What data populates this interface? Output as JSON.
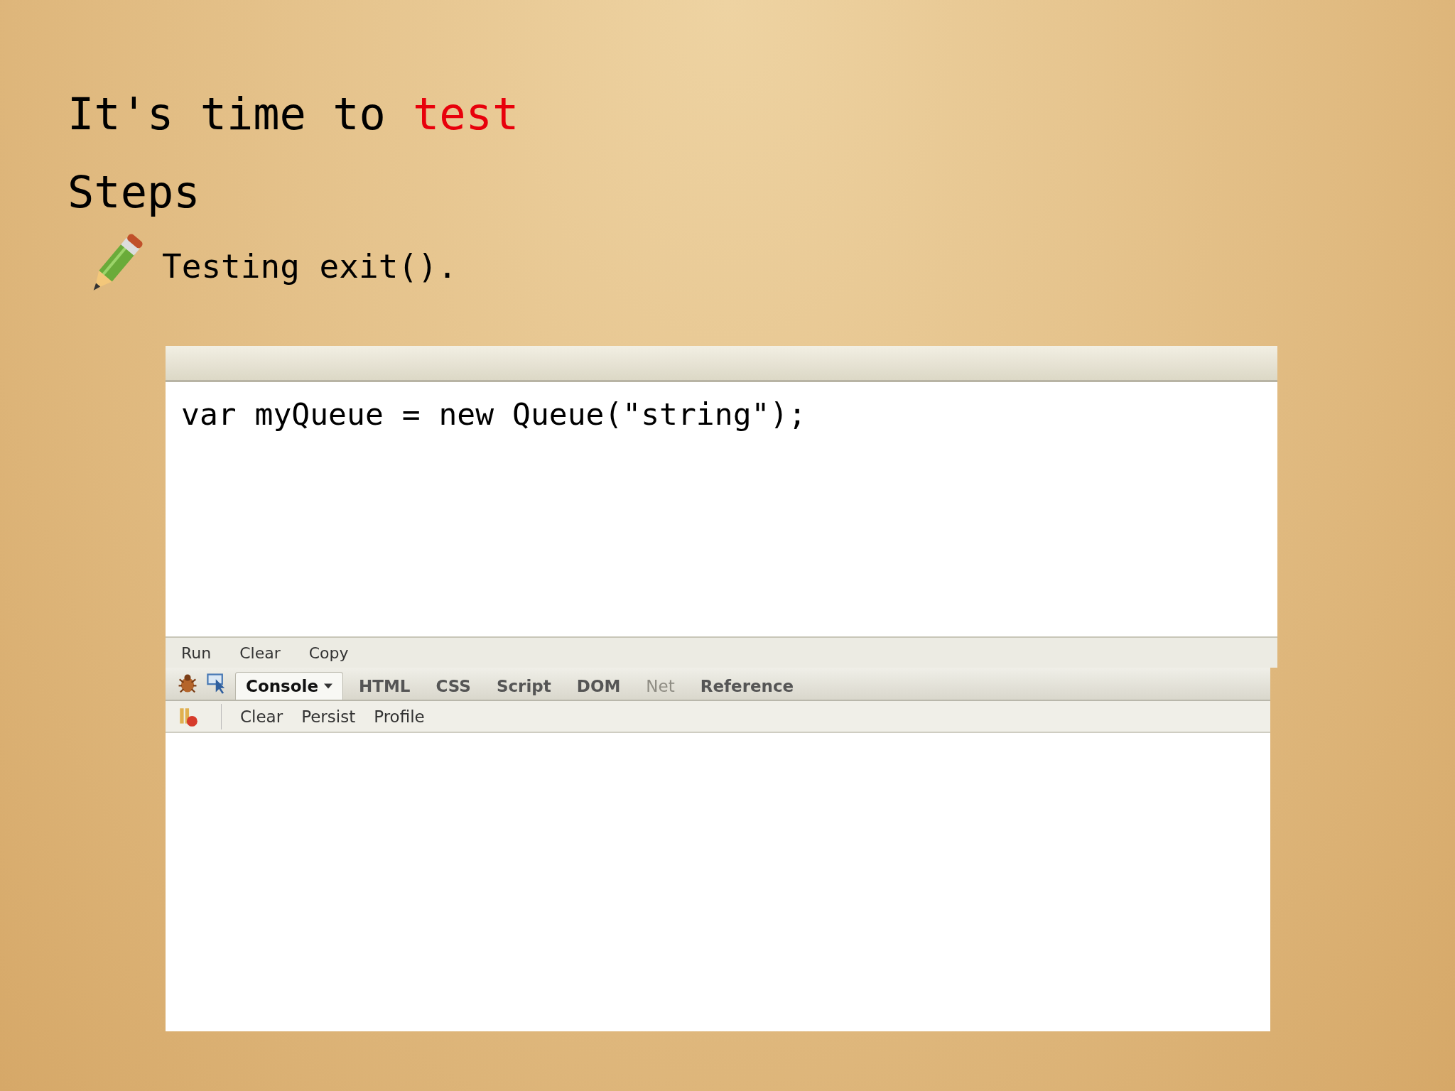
{
  "title": {
    "text": "It's time to",
    "highlight": "test"
  },
  "subtitle": "Steps",
  "bullets": [
    "Testing exit()."
  ],
  "editor": {
    "code": "var myQueue = new Queue(\"string\");",
    "commands": [
      "Run",
      "Clear",
      "Copy"
    ]
  },
  "tabs": [
    {
      "label": "Console",
      "selected": true,
      "disabled": false,
      "dropdown": true
    },
    {
      "label": "HTML",
      "selected": false,
      "disabled": false,
      "dropdown": false
    },
    {
      "label": "CSS",
      "selected": false,
      "disabled": false,
      "dropdown": false
    },
    {
      "label": "Script",
      "selected": false,
      "disabled": false,
      "dropdown": false
    },
    {
      "label": "DOM",
      "selected": false,
      "disabled": false,
      "dropdown": false
    },
    {
      "label": "Net",
      "selected": false,
      "disabled": true,
      "dropdown": false
    },
    {
      "label": "Reference",
      "selected": false,
      "disabled": false,
      "dropdown": false
    }
  ],
  "console_toolbar": [
    "Clear",
    "Persist",
    "Profile"
  ]
}
